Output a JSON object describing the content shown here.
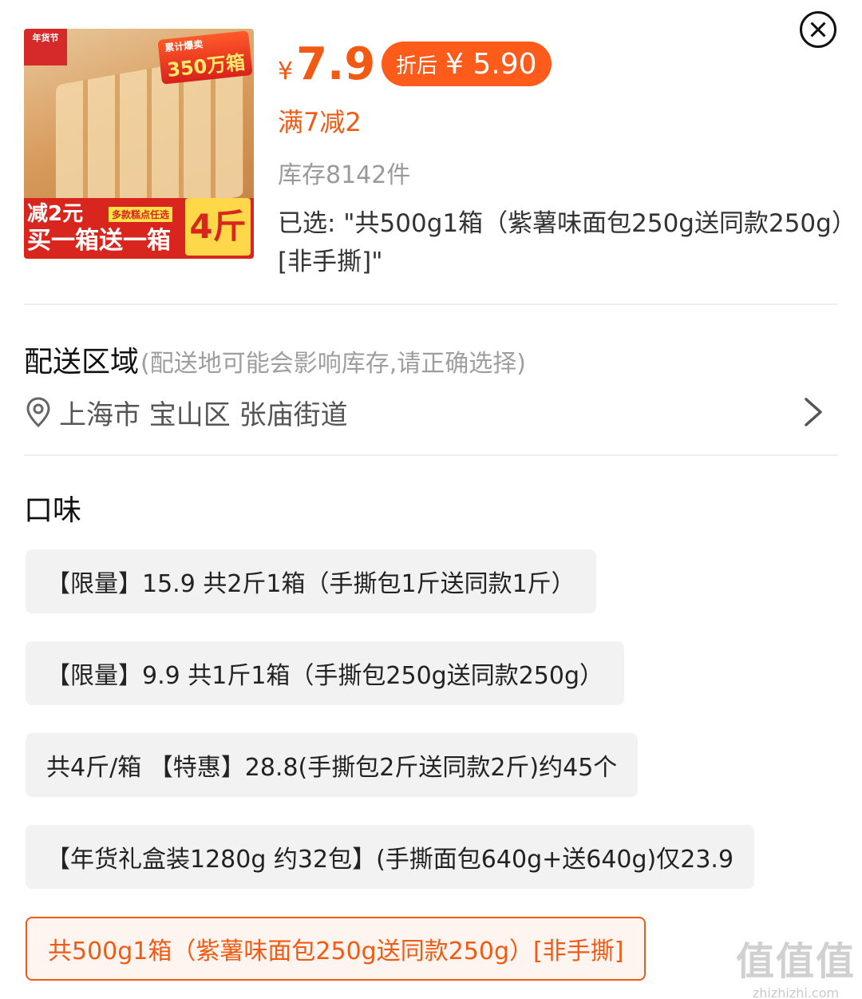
{
  "product": {
    "image_text": {
      "corner": "年货节",
      "top_banner_small": "累计爆卖",
      "top_banner": "350万箱",
      "strip_line1": "减2元",
      "strip_tag": "多款糕点任选",
      "strip_line2": "买一箱送一箱",
      "strip_big": "4斤"
    },
    "price_symbol": "¥",
    "price": "7.9",
    "discount_label": "折后",
    "discount_price": "¥ 5.90",
    "promo": "满7减2",
    "stock": "库存8142件",
    "selected": "已选: \"共500g1箱（紫薯味面包250g送同款250g）[非手撕]\""
  },
  "delivery": {
    "title": "配送区域",
    "hint": "(配送地可能会影响库存,请正确选择)",
    "address": "上海市 宝山区 张庙街道"
  },
  "flavor": {
    "title": "口味",
    "options": [
      "【限量】15.9 共2斤1箱（手撕包1斤送同款1斤）",
      "【限量】9.9 共1斤1箱（手撕包250g送同款250g）",
      "共4斤/箱 【特惠】28.8(手撕包2斤送同款2斤)约45个",
      "【年货礼盒装1280g 约32包】(手撕面包640g+送640g)仅23.9",
      "共500g1箱（紫薯味面包250g送同款250g）[非手撕]"
    ],
    "selected_index": 4
  },
  "watermark": {
    "big": "值值值",
    "small": "zhizhizhi.com"
  },
  "colors": {
    "accent": "#f25a14",
    "discount_bg": "#ff5b1a",
    "option_bg": "#f2f2f2"
  },
  "icons": [
    "close-icon",
    "location-pin-icon",
    "chevron-right-icon"
  ]
}
